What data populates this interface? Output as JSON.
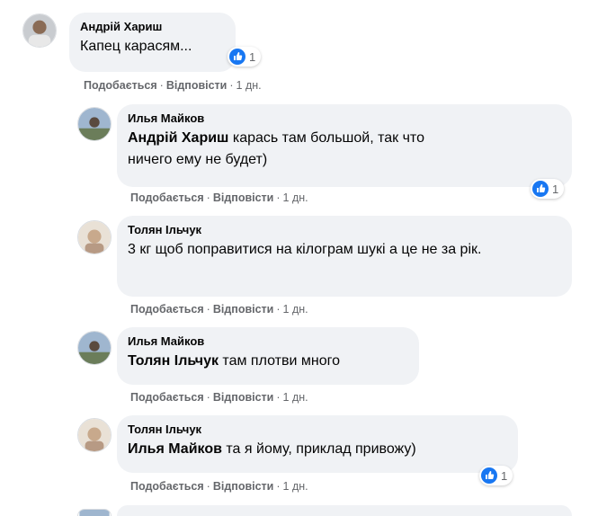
{
  "comments": [
    {
      "author": "Андрій Хариш",
      "mention": "",
      "text": "Капец карасям...",
      "like_label": "Подобається",
      "reply_label": "Відповісти",
      "time": "1 дн.",
      "reactions": "1"
    },
    {
      "author": "Илья Майков",
      "mention": "Андрій Хариш",
      "text": " карась там большой, так что ничего ему не будет)",
      "like_label": "Подобається",
      "reply_label": "Відповісти",
      "time": "1 дн.",
      "reactions": "1"
    },
    {
      "author": "Толян Ільчук",
      "mention": "",
      "text": "3 кг щоб поправитися на кілограм шукі а це не за рік.",
      "like_label": "Подобається",
      "reply_label": "Відповісти",
      "time": "1 дн."
    },
    {
      "author": "Илья Майков",
      "mention": "Толян Ільчук",
      "text": " там плотви много",
      "like_label": "Подобається",
      "reply_label": "Відповісти",
      "time": "1 дн."
    },
    {
      "author": "Толян Ільчук",
      "mention": "Илья Майков",
      "text": " та я йому, приклад привожу)",
      "like_label": "Подобається",
      "reply_label": "Відповісти",
      "time": "1 дн.",
      "reactions": "1"
    }
  ],
  "separator": "·",
  "colors": {
    "bubble": "#f0f2f5",
    "action_text": "#65676b",
    "like_blue": "#1877f2"
  },
  "icons": {
    "like": "like-icon",
    "avatar": "avatar-photo"
  }
}
